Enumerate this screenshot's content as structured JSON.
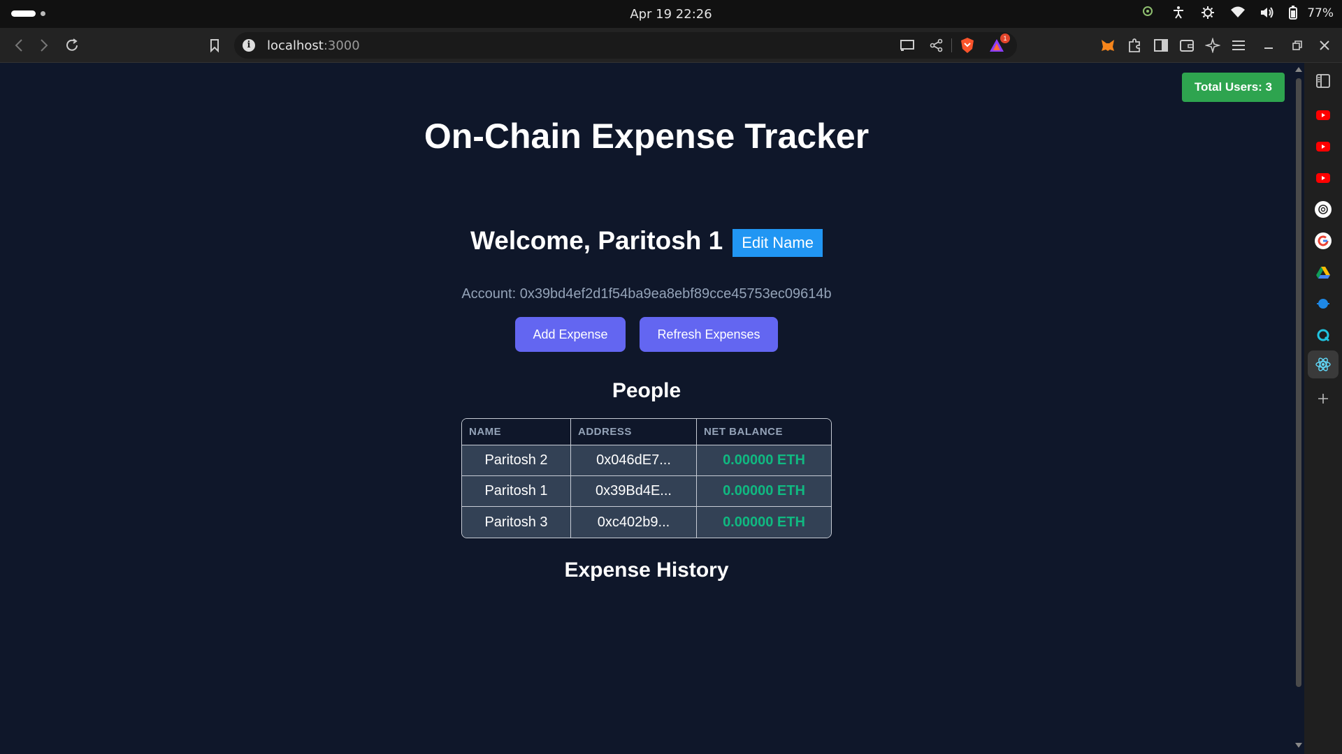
{
  "os": {
    "clock": "Apr 19  22:26",
    "battery": "77%"
  },
  "browser": {
    "url_host": "localhost",
    "url_port": ":3000",
    "notification_count": "1"
  },
  "page": {
    "total_users": "Total Users: 3",
    "title": "On-Chain Expense Tracker",
    "welcome": "Welcome, Paritosh 1",
    "edit_name_label": "Edit Name",
    "account": "Account: 0x39bd4ef2d1f54ba9ea8ebf89cce45753ec09614b",
    "add_expense_label": "Add Expense",
    "refresh_expenses_label": "Refresh Expenses",
    "people_heading": "People",
    "people_table": {
      "headers": [
        "NAME",
        "ADDRESS",
        "NET BALANCE"
      ],
      "rows": [
        {
          "name": "Paritosh 2",
          "address": "0x046dE7...",
          "balance": "0.00000 ETH"
        },
        {
          "name": "Paritosh 1",
          "address": "0x39Bd4E...",
          "balance": "0.00000 ETH"
        },
        {
          "name": "Paritosh 3",
          "address": "0xc402b9...",
          "balance": "0.00000 ETH"
        }
      ]
    },
    "expense_history_heading": "Expense History"
  },
  "colors": {
    "background": "#0f172a",
    "total_users_badge": "#2ea44f",
    "edit_button": "#2196f3",
    "action_button": "#6366f1",
    "balance_text": "#10b981",
    "table_row": "#334155"
  }
}
